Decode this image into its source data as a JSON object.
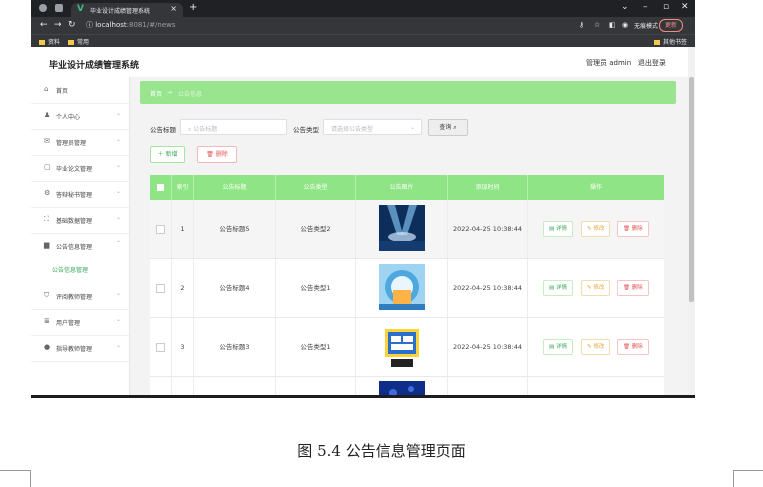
{
  "browser": {
    "tab_title": "毕业设计成绩管理系统",
    "tab_close": "×",
    "new_tab": "+",
    "url_host": "localhost",
    "url_rest": ":8081/#/news",
    "incognito_label": "无痕模式",
    "update_label": "更新",
    "bookmarks": [
      "资料",
      "常用"
    ],
    "other_bookmarks": "其他书签"
  },
  "app": {
    "title": "毕业设计成绩管理系统",
    "user_label": "管理员 admin",
    "logout_label": "退出登录"
  },
  "sidebar": {
    "items": [
      {
        "icon": "home-icon",
        "glyph": "⌂",
        "label": "首页",
        "arrow": ""
      },
      {
        "icon": "user-icon",
        "glyph": "♟",
        "label": "个人中心",
        "arrow": "⌄"
      },
      {
        "icon": "mail-icon",
        "glyph": "✉",
        "label": "管理员管理",
        "arrow": "⌄"
      },
      {
        "icon": "document-icon",
        "glyph": "▢",
        "label": "毕业论文管理",
        "arrow": "⌄"
      },
      {
        "icon": "settings-icon",
        "glyph": "⚙",
        "label": "答辩秘书管理",
        "arrow": "⌄"
      },
      {
        "icon": "fullscreen-icon",
        "glyph": "⛶",
        "label": "基础数据管理",
        "arrow": "⌄"
      },
      {
        "icon": "monitor-icon",
        "glyph": "▆",
        "label": "公告信息管理",
        "arrow": "⌃"
      },
      {
        "icon": "shield-icon",
        "glyph": "⛉",
        "label": "评阅教师管理",
        "arrow": "⌄"
      },
      {
        "icon": "list-icon",
        "glyph": "≣",
        "label": "用户管理",
        "arrow": "⌄"
      },
      {
        "icon": "pin-icon",
        "glyph": "●",
        "label": "指导教师管理",
        "arrow": "⌄"
      }
    ],
    "active_sub": "公告信息管理"
  },
  "breadcrumb": {
    "home": "首页",
    "arrow": "→",
    "current": "公告信息"
  },
  "search": {
    "title_label": "公告标题",
    "title_placeholder": "公告标题",
    "type_label": "公告类型",
    "type_placeholder": "请选择公告类型",
    "query_button": "查询"
  },
  "actions": {
    "add": "新增",
    "delete": "删除"
  },
  "table": {
    "headers": [
      "索引",
      "公告标题",
      "公告类型",
      "公告图片",
      "添加时间",
      "操作"
    ],
    "rows": [
      {
        "index": "1",
        "title": "公告标题5",
        "type": "公告类型2",
        "time": "2022-04-25 10:38:44"
      },
      {
        "index": "2",
        "title": "公告标题4",
        "type": "公告类型1",
        "time": "2022-04-25 10:38:44"
      },
      {
        "index": "3",
        "title": "公告标题3",
        "type": "公告类型1",
        "time": "2022-04-25 10:38:44"
      }
    ],
    "op_detail": "详情",
    "op_edit": "修改",
    "op_delete": "删除"
  },
  "caption": "图 5.4  公告信息管理页面",
  "colors": {
    "accent": "#8fe485",
    "breadcrumb": "#98e58e",
    "chrome": "#202124"
  }
}
